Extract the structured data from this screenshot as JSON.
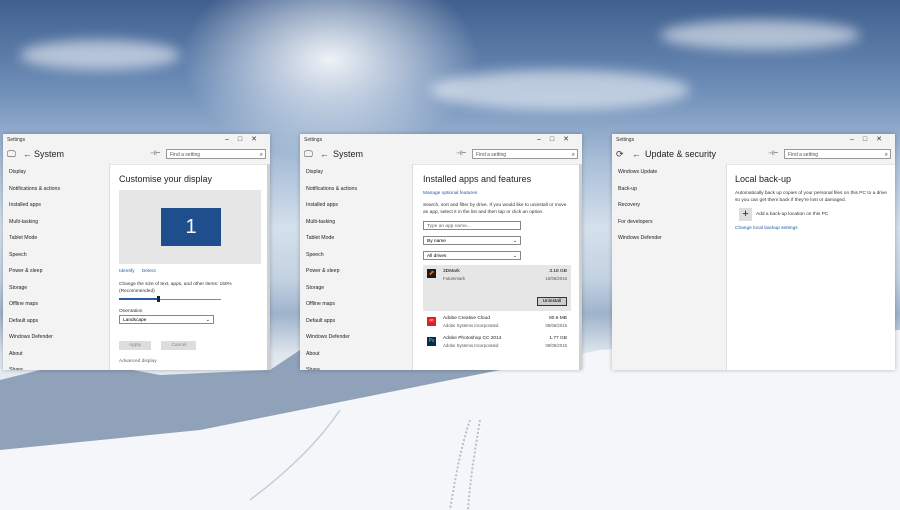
{
  "windows": {
    "display": {
      "titlebar": "Settings",
      "header_title": "System",
      "search_placeholder": "Find a setting",
      "sidebar": [
        "Display",
        "Notifications & actions",
        "Installed apps",
        "Multi-tasking",
        "Tablet Mode",
        "Speech",
        "Power & sleep",
        "Storage",
        "Offline maps",
        "Default apps",
        "Windows Defender",
        "About",
        "Share"
      ],
      "page_title": "Customise your display",
      "monitor_number": "1",
      "identify_label": "Identify",
      "detect_label": "Detect",
      "scale_text": "Change the size of text, apps, and other items: 150% (Recommended)",
      "scale_fraction": 0.38,
      "orientation_label": "Orientation",
      "orientation_value": "Landscape",
      "apply_label": "Apply",
      "cancel_label": "Cancel",
      "cut_label": "Advanced display"
    },
    "apps": {
      "titlebar": "Settings",
      "header_title": "System",
      "search_placeholder": "Find a setting",
      "sidebar": [
        "Display",
        "Notifications & actions",
        "Installed apps",
        "Multi-tasking",
        "Tablet Mode",
        "Speech",
        "Power & sleep",
        "Storage",
        "Offline maps",
        "Default apps",
        "Windows Defender",
        "About",
        "Share"
      ],
      "page_title": "Installed apps and features",
      "manage_link": "Manage optional features",
      "description": "Search, sort and filter by drive. If you would like to uninstall or move an app, select it in the list and then tap or click an option.",
      "search_apps_placeholder": "Type an app name...",
      "sort_value": "By name",
      "drive_value": "All drives",
      "apps": [
        {
          "name": "3DMark",
          "publisher": "Futuremark",
          "size": "3.18 GB",
          "date": "15/06/2015"
        },
        {
          "name": "Adobe Creative Cloud",
          "publisher": "Adobe Systems Incorporated",
          "size": "80.6 MB",
          "date": "09/06/2015"
        },
        {
          "name": "Adobe Photoshop CC 2014",
          "publisher": "Adobe Systems Incorporated",
          "size": "1.77 GB",
          "date": "09/06/2015"
        }
      ],
      "uninstall_label": "Uninstall"
    },
    "update": {
      "titlebar": "Settings",
      "header_title": "Update & security",
      "search_placeholder": "Find a setting",
      "sidebar": [
        "Windows Update",
        "Back-up",
        "Recovery",
        "For developers",
        "Windows Defender"
      ],
      "page_title": "Local back-up",
      "description": "Automatically back up copies of your personal files on this PC to a drive so you can get them back if they're lost or damaged.",
      "add_label": "Add a back-up location on this PC",
      "settings_link": "Change local backup settings"
    }
  },
  "colors": {
    "accent": "#2a5aa8",
    "monitor": "#1f4e8c",
    "sidebar_bg": "#f3f3f3"
  }
}
